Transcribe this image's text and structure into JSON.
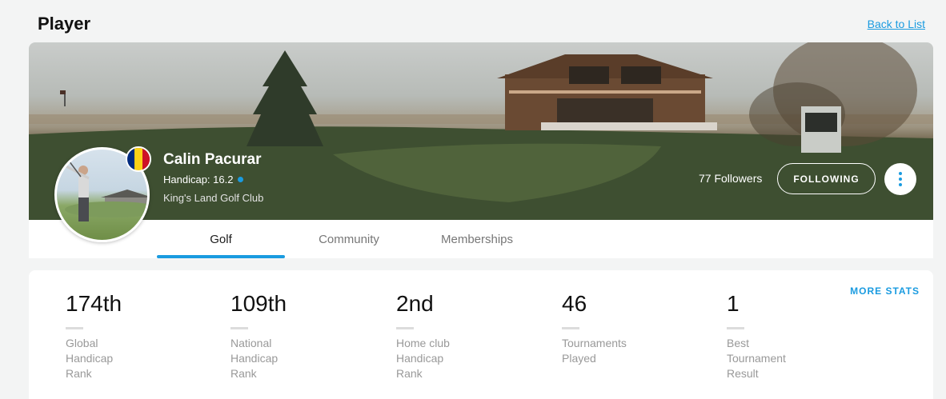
{
  "header": {
    "title": "Player",
    "back_link": "Back to List"
  },
  "player": {
    "name": "Calin Pacurar",
    "handicap": "Handicap: 16.2",
    "club": "King's Land Golf Club",
    "flag_colors": [
      "#002b7f",
      "#fcd116",
      "#ce1126"
    ]
  },
  "social": {
    "followers": "77 Followers",
    "following_label": "FOLLOWING"
  },
  "tabs": [
    {
      "label": "Golf",
      "active": true
    },
    {
      "label": "Community",
      "active": false
    },
    {
      "label": "Memberships",
      "active": false
    }
  ],
  "stats": {
    "more_stats": "MORE STATS",
    "items": [
      {
        "value": "174th",
        "label": "Global\nHandicap\nRank"
      },
      {
        "value": "109th",
        "label": "National\nHandicap\nRank"
      },
      {
        "value": "2nd",
        "label": "Home club\nHandicap\nRank"
      },
      {
        "value": "46",
        "label": "Tournaments\nPlayed"
      },
      {
        "value": "1",
        "label": "Best\nTournament\nResult"
      }
    ]
  },
  "colors": {
    "accent": "#1a9be0"
  }
}
